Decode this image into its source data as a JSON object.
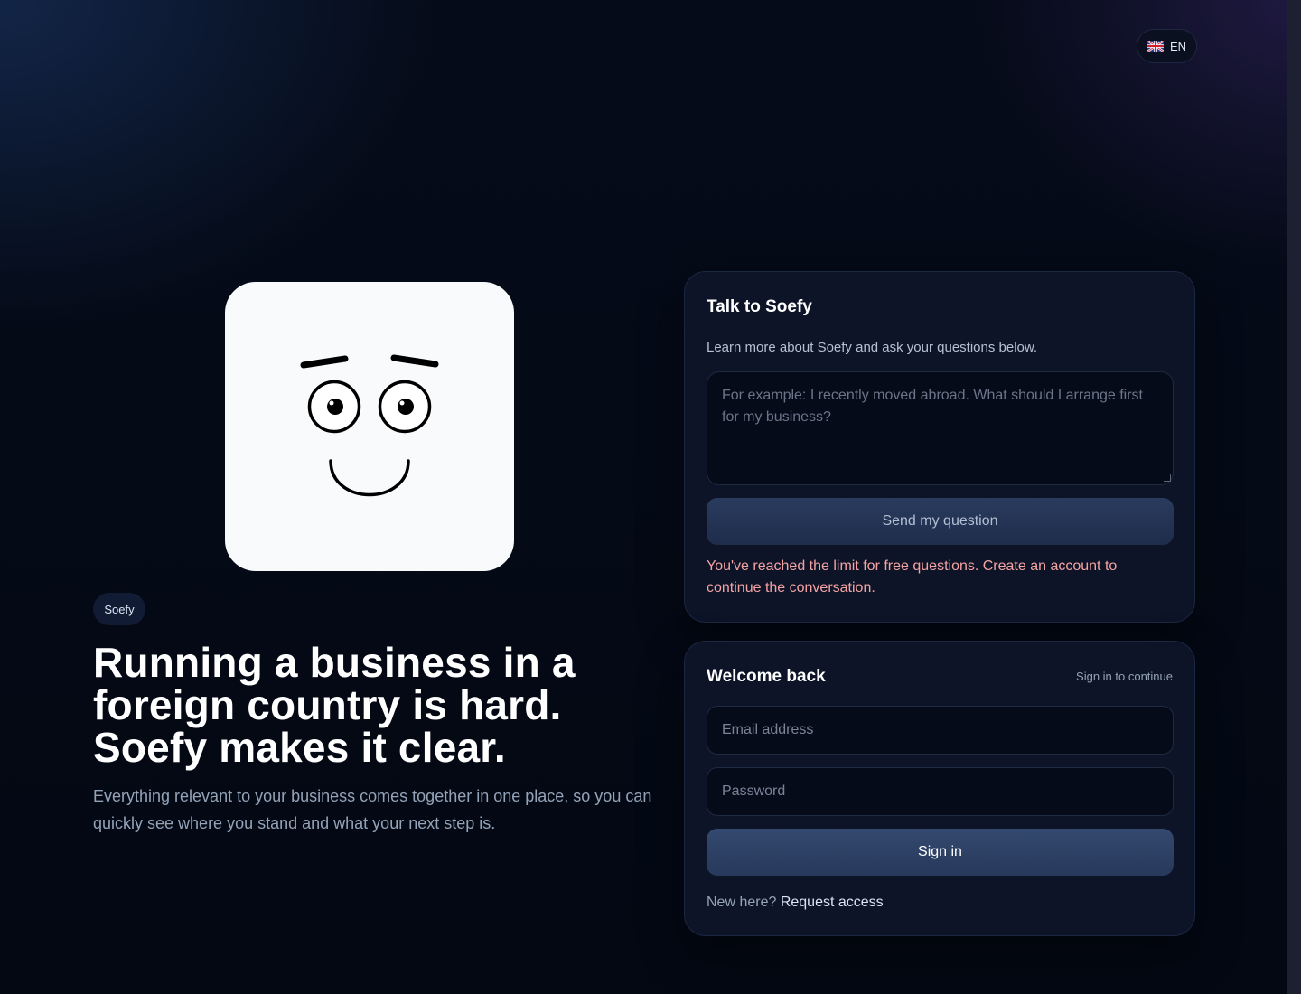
{
  "header": {
    "language": "EN",
    "flag_icon": "uk-flag-icon"
  },
  "hero": {
    "mascot_icon": "smiling-face-icon",
    "badge": "Soefy",
    "title": "Running a business in a foreign country is hard. Soefy makes it clear.",
    "subtitle": "Everything relevant to your business comes together in one place, so you can quickly see where you stand and what your next step is."
  },
  "chat": {
    "title": "Talk to Soefy",
    "description": "Learn more about Soefy and ask your questions below.",
    "placeholder": "For example: I recently moved abroad. What should I arrange first for my business?",
    "send_label": "Send my question",
    "limit_message": "You've reached the limit for free questions. Create an account to continue the conversation."
  },
  "login": {
    "title": "Welcome back",
    "hint": "Sign in to continue",
    "email_placeholder": "Email address",
    "password_placeholder": "Password",
    "signin_label": "Sign in",
    "new_here": "New here?",
    "request_access": "Request access"
  },
  "colors": {
    "background": "#040a16",
    "card": "#0d1427",
    "button": "#27395c",
    "error_text": "#f4a3a3"
  }
}
